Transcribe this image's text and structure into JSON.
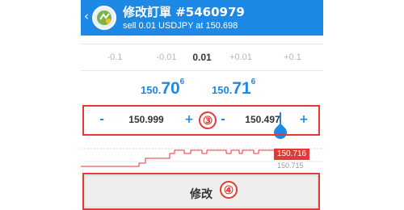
{
  "header": {
    "back_icon": "chevron-left-icon",
    "title": "修改訂單 #5460979",
    "subtitle": "sell 0.01 USDJPY at 150.698",
    "color": "#1e88e5"
  },
  "volume": {
    "options": [
      "-0.1",
      "-0.01",
      "0.01",
      "+0.01",
      "+0.1"
    ],
    "selected_index": 2
  },
  "prices": {
    "bid": {
      "main": "150.",
      "big": "70",
      "sup": "6"
    },
    "ask": {
      "main": "150.",
      "big": "71",
      "sup": "6"
    },
    "color": "#1e88e5"
  },
  "stop_loss": {
    "minus": "-",
    "value": "150.999",
    "plus": "+"
  },
  "take_profit": {
    "minus": "-",
    "value": "150.497",
    "plus": "+"
  },
  "chart": {
    "current_price_tag": "150.716",
    "secondary_price_label": "150.715",
    "line_color": "#e53935"
  },
  "annotations": {
    "sltp_marker": "③",
    "modify_marker": "④",
    "color": "#e53935"
  },
  "modify_button": {
    "label": "修改"
  }
}
